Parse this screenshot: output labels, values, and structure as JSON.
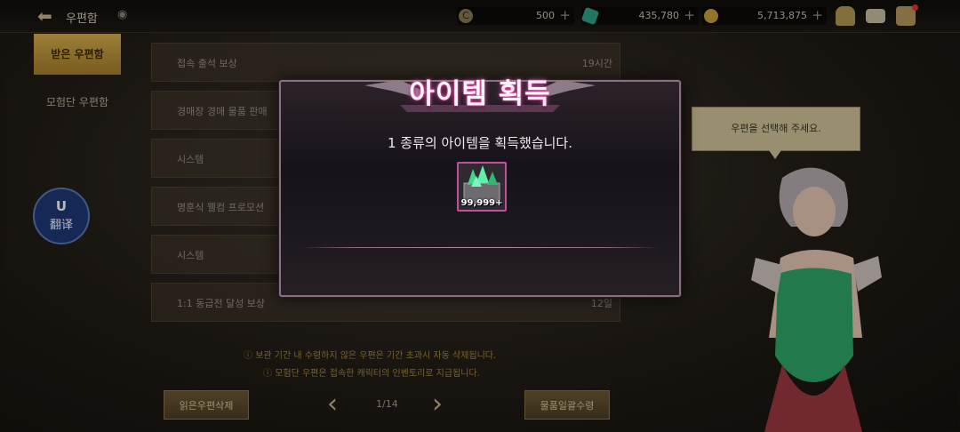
{
  "header": {
    "title": "우편함",
    "currencies": [
      {
        "icon": "coin-c-icon",
        "value": "500"
      },
      {
        "icon": "green-gem-icon",
        "value": "435,780"
      },
      {
        "icon": "gold-coin-icon",
        "value": "5,713,875"
      }
    ]
  },
  "sidebar": {
    "tabs": [
      {
        "label": "받은 우편함",
        "active": true
      },
      {
        "label": "모험단 우편함",
        "active": false
      }
    ]
  },
  "translate_button": {
    "logo": "U",
    "label": "翻译"
  },
  "mail_list": [
    {
      "label": "접속 출석 보상",
      "time": "19시간"
    },
    {
      "label": "경매장 경매 물품 판매",
      "time": ""
    },
    {
      "label": "시스템",
      "time": ""
    },
    {
      "label": "명훈식 웰컴 프로모션",
      "time": ""
    },
    {
      "label": "시스템",
      "time": ""
    },
    {
      "label": "1:1 동급전 달성 보상",
      "time": "12일"
    }
  ],
  "notices": [
    "보관 기간 내 수령하지 않은 우편은 기간 초과시 자동 삭제됩니다.",
    "모험단 우편은 접속한 캐릭터의 인벤토리로 지급됩니다."
  ],
  "footer": {
    "delete_read_label": "읽은우편삭제",
    "page": "1/14",
    "receive_all_label": "물품일괄수령"
  },
  "npc": {
    "speech": "우편을 선택해 주세요."
  },
  "popup": {
    "title": "아이템 획득",
    "message": "1 종류의 아이템을 획득했습니다.",
    "item": {
      "icon": "green-crystal-chest-icon",
      "quantity": "99,999+",
      "frame_color": "#c24f9a"
    }
  }
}
